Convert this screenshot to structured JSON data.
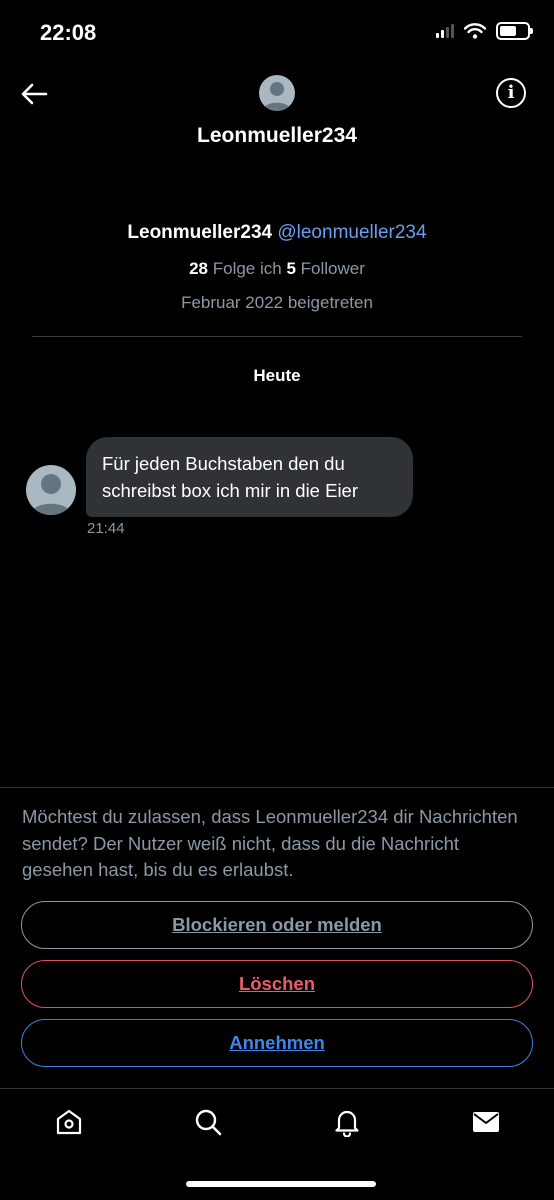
{
  "status_bar": {
    "time": "22:08"
  },
  "header": {
    "title": "Leonmueller234"
  },
  "icons": {
    "back": "back-arrow-icon",
    "info": "info-icon",
    "info_glyph": "i",
    "home": "home-icon",
    "search": "search-icon",
    "notifications": "bell-icon",
    "messages": "envelope-icon"
  },
  "profile": {
    "name": "Leonmueller234",
    "handle": "@leonmueller234",
    "following_count": "28",
    "following_label": "Folge ich",
    "followers_count": "5",
    "followers_label": "Follower",
    "joined": "Februar 2022 beigetreten"
  },
  "conversation": {
    "day_label": "Heute",
    "messages": [
      {
        "text": "Für jeden Buchstaben den du schreibst box ich mir in die Eier",
        "time": "21:44"
      }
    ]
  },
  "request": {
    "prompt": "Möchtest du zulassen, dass Leonmueller234 dir Nachrichten sendet? Der Nutzer weiß nicht, dass du die Nachricht gesehen hast, bis du es erlaubst.",
    "block_label": "Blockieren oder melden",
    "delete_label": "Löschen",
    "accept_label": "Annehmen"
  },
  "colors": {
    "background": "#000000",
    "bubble": "#2f3336",
    "handle_link": "#6a9ff0",
    "muted_text": "#8b98a5",
    "delete": "#ee5a66",
    "accept": "#3f86ea"
  }
}
